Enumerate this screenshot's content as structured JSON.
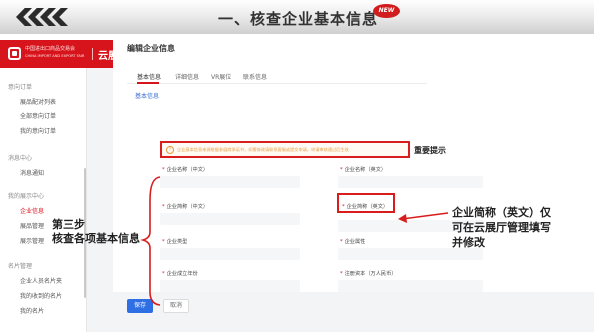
{
  "banner": {
    "title": "一、核查企业基本信息",
    "new_badge": "NEW"
  },
  "header": {
    "logo_text_line1": "中国进出口商品交易会",
    "logo_text_line2": "CHINA IMPORT AND EXPORT FAIR",
    "system_title": "云展厅管理",
    "help_icon": "help-icon",
    "bell_icon": "bell-icon",
    "user_icon": "user-icon"
  },
  "sidebar": {
    "groups": [
      {
        "label": "意向订单",
        "items": [
          "展品配对列表",
          "全部意向订单",
          "我的意向订单"
        ]
      },
      {
        "label": "消息中心",
        "items": [
          "消息通知"
        ]
      },
      {
        "label": "我的展示中心",
        "items": [
          "企业信息",
          "展品管理",
          "展示管理"
        ]
      },
      {
        "label": "名片管理",
        "items": [
          "企业人员名片夹",
          "我的收到的名片",
          "我的名片"
        ]
      }
    ],
    "active_item": "企业信息"
  },
  "main": {
    "title": "编辑企业信息",
    "tabs": [
      "基本信息",
      "详细信息",
      "VR展位",
      "联系信息"
    ],
    "section_title": "基本信息",
    "notice": "企业基本信息来源根据参展商承诺书，如需修改请联系客服或提交申请，申请审核通过后生效",
    "fields": [
      {
        "label": "企业名称（中文）",
        "required": true
      },
      {
        "label": "企业名称（英文）",
        "required": true
      },
      {
        "label": "企业简称（中文）",
        "required": true
      },
      {
        "label": "企业简称（英文）",
        "required": true
      },
      {
        "label": "企业类型",
        "required": true
      },
      {
        "label": "企业属性",
        "required": true
      },
      {
        "label": "企业成立年份",
        "required": true
      },
      {
        "label": "注册资本（万人民币）",
        "required": true
      }
    ],
    "save_label": "保存",
    "cancel_label": "取消"
  },
  "annotations": {
    "important_tip": "重要提示",
    "step_line1": "第三步",
    "step_line2": "核查各项基本信息",
    "note_line1": "企业简称（英文）仅",
    "note_line2": "可在云展厅管理填写",
    "note_line3": "并修改"
  },
  "colors": {
    "brand_red": "#d7141c",
    "annotation_red": "#d91c1c",
    "primary_blue": "#2f6fe4",
    "notice_orange": "#e8a24b"
  }
}
